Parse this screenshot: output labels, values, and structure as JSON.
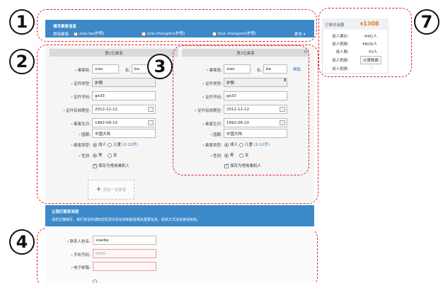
{
  "header": {
    "title": "填写乘客信息",
    "frequent_label": "常用乘客:",
    "passengers": [
      "xiao ba(护照)",
      "one chengren(护照)",
      "four chengren(护照)"
    ],
    "more": "更多"
  },
  "tabs": [
    "第1位乘客",
    "第2位乘客"
  ],
  "form_labels": {
    "name": "乘客姓:",
    "given": "名:",
    "id_type": "证件类型:",
    "id_no": "证件号码:",
    "expiry": "证件有效期至:",
    "birthday": "乘客生日:",
    "nationality": "国籍:",
    "pax_type": "乘客类型:",
    "gender": "性别:",
    "help": "帮助"
  },
  "passenger1": {
    "surname": "xiao",
    "given": "ba",
    "id_type": "护照",
    "id_no": "ge33",
    "expiry": "2012-12-12",
    "birthday": "1992-06-10",
    "nationality": "中国大陆",
    "adult": "成人",
    "child": "儿童",
    "child_note": "(2-12岁)",
    "male": "男",
    "female": "女",
    "save": "保存为常用乘机人"
  },
  "passenger2": {
    "surname": "xiao",
    "given": "ba",
    "id_type": "护照",
    "id_no": "ge33",
    "expiry": "2012-12-12",
    "birthday": "1992-06-10",
    "nationality": "中国大陆",
    "adult": "成人",
    "child": "儿童",
    "child_note": "(2-12岁)",
    "male": "男",
    "female": "女",
    "save": "保存为常用乘机人"
  },
  "add_passenger": "添加一位乘客",
  "contact": {
    "title": "让我们联系到您",
    "note": "请您正确填写，我们将及时通知您机票出票状态和航班相关重要信息，联系方式没有其他用途。",
    "name_label": "联系人姓名:",
    "name_value": "xiaoba",
    "phone_label": "手机号码:",
    "phone_placeholder": "0086-",
    "email_label": "电子邮箱:"
  },
  "order": {
    "title": "订单总金额",
    "currency": "¥",
    "total": "1308",
    "rows": [
      {
        "label": "成人票价:",
        "value": "¥45/人"
      },
      {
        "label": "成人税费:",
        "value": "¥609/人"
      },
      {
        "label": "成人数:",
        "value": "¥2人"
      },
      {
        "label": "成人税费:",
        "value": "计算税费"
      },
      {
        "label": "成人税费:",
        "value": ""
      }
    ]
  },
  "annotations": [
    "1",
    "2",
    "3",
    "4",
    "7"
  ]
}
